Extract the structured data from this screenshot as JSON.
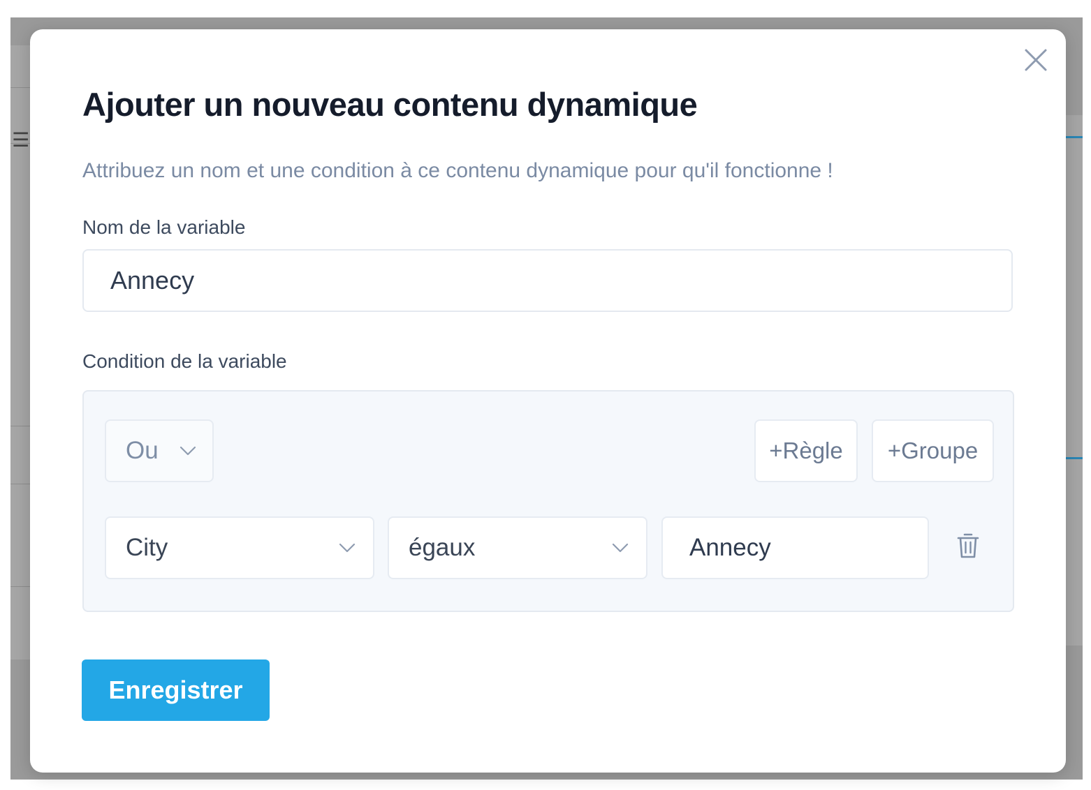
{
  "modal": {
    "title": "Ajouter un nouveau contenu dynamique",
    "subtitle": "Attribuez un nom et une condition à ce contenu dynamique pour qu'il fonctionne !",
    "close_icon": "close-icon"
  },
  "variable_name": {
    "label": "Nom de la variable",
    "value": "Annecy"
  },
  "condition": {
    "label": "Condition de la variable",
    "logic": {
      "selected": "Ou"
    },
    "add_rule_label": "+Règle",
    "add_group_label": "+Groupe",
    "rules": [
      {
        "field": "City",
        "operator": "égaux",
        "value": "Annecy"
      }
    ]
  },
  "actions": {
    "save_label": "Enregistrer"
  },
  "colors": {
    "primary": "#23a7e6",
    "title_text": "#151c2b",
    "muted_text": "#7a8aa3",
    "panel_bg": "#f5f8fc",
    "border": "#e4e9f0"
  }
}
